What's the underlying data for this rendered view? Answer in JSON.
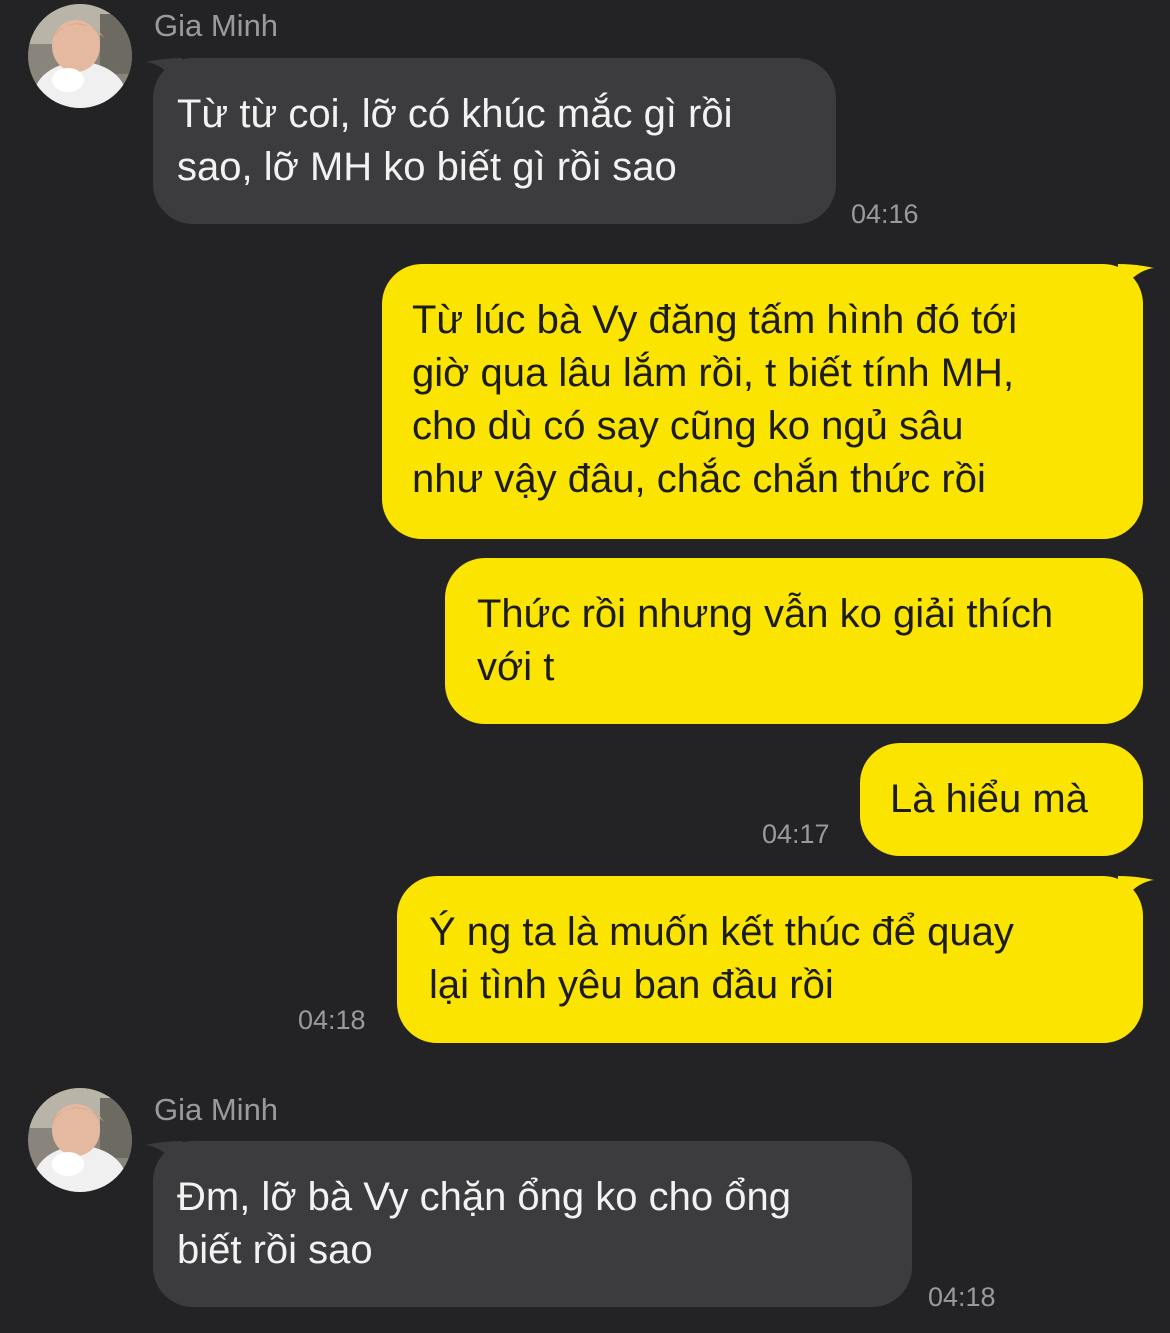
{
  "chat": {
    "messages": [
      {
        "sender": "Gia Minh",
        "lines": [
          "Từ từ coi, lỡ có khúc mắc gì rồi",
          "sao, lỡ MH ko biết gì rồi sao"
        ],
        "time": "04:16"
      },
      {
        "lines": [
          "Từ lúc bà Vy đăng tấm hình đó tới",
          "giờ qua lâu lắm rồi, t biết tính MH,",
          "cho dù có say cũng ko ngủ sâu",
          "như vậy đâu, chắc chắn thức rồi"
        ]
      },
      {
        "lines": [
          "Thức rồi nhưng vẫn ko giải thích",
          "với t"
        ]
      },
      {
        "lines": [
          "Là hiểu mà"
        ],
        "time": "04:17"
      },
      {
        "lines": [
          "Ý ng ta là muốn kết thúc để quay",
          "lại tình yêu ban đầu rồi"
        ],
        "time": "04:18"
      },
      {
        "sender": "Gia Minh",
        "lines": [
          "Đm, lỡ bà Vy chặn ổng ko cho ổng",
          "biết rồi sao"
        ],
        "time": "04:18"
      }
    ]
  },
  "colors": {
    "background": "#232325",
    "incoming_bubble": "#3c3c3f",
    "outgoing_bubble": "#fbe500",
    "meta_text": "#9a9a9e"
  },
  "icons": {
    "avatar": "profile-photo"
  }
}
